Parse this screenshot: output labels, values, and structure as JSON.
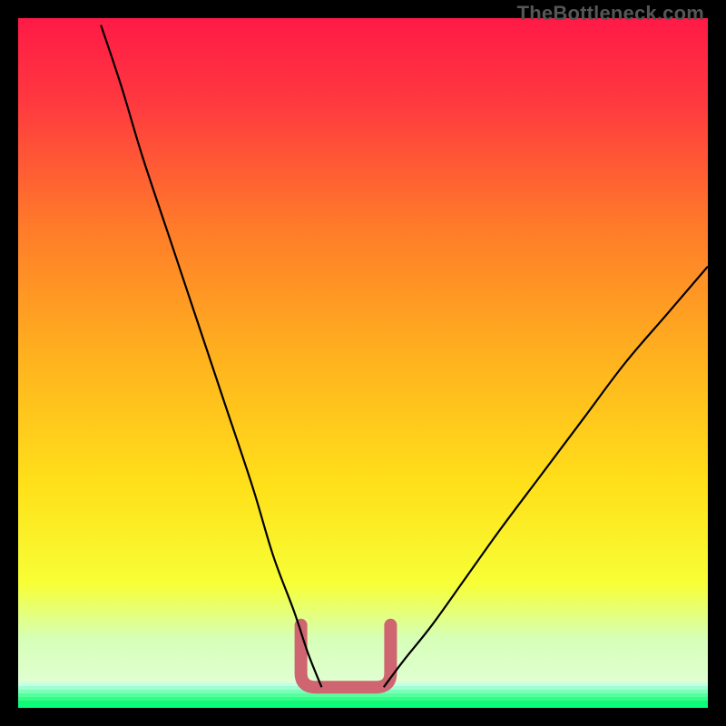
{
  "watermark": "TheBottleneck.com",
  "chart_data": {
    "type": "line",
    "title": "",
    "xlabel": "",
    "ylabel": "",
    "xlim": [
      0,
      100
    ],
    "ylim": [
      0,
      100
    ],
    "grid": false,
    "background_gradient": {
      "top": "#ff1a46",
      "mid": "#ffe11a",
      "bottom": "#07ff7c"
    },
    "series": [
      {
        "name": "left-curve",
        "x": [
          12,
          15,
          18,
          22,
          26,
          30,
          34,
          37,
          40,
          42,
          44
        ],
        "values": [
          99,
          90,
          80,
          68,
          56,
          44,
          32,
          22,
          14,
          8,
          3
        ]
      },
      {
        "name": "right-curve",
        "x": [
          53,
          56,
          60,
          65,
          70,
          76,
          82,
          88,
          94,
          100
        ],
        "values": [
          3,
          7,
          12,
          19,
          26,
          34,
          42,
          50,
          57,
          64
        ]
      }
    ],
    "highlight_brace": {
      "left_x": 41,
      "right_x": 54,
      "base_y": 3,
      "wing_height": 9,
      "color": "#cf6570"
    },
    "annotations": []
  }
}
